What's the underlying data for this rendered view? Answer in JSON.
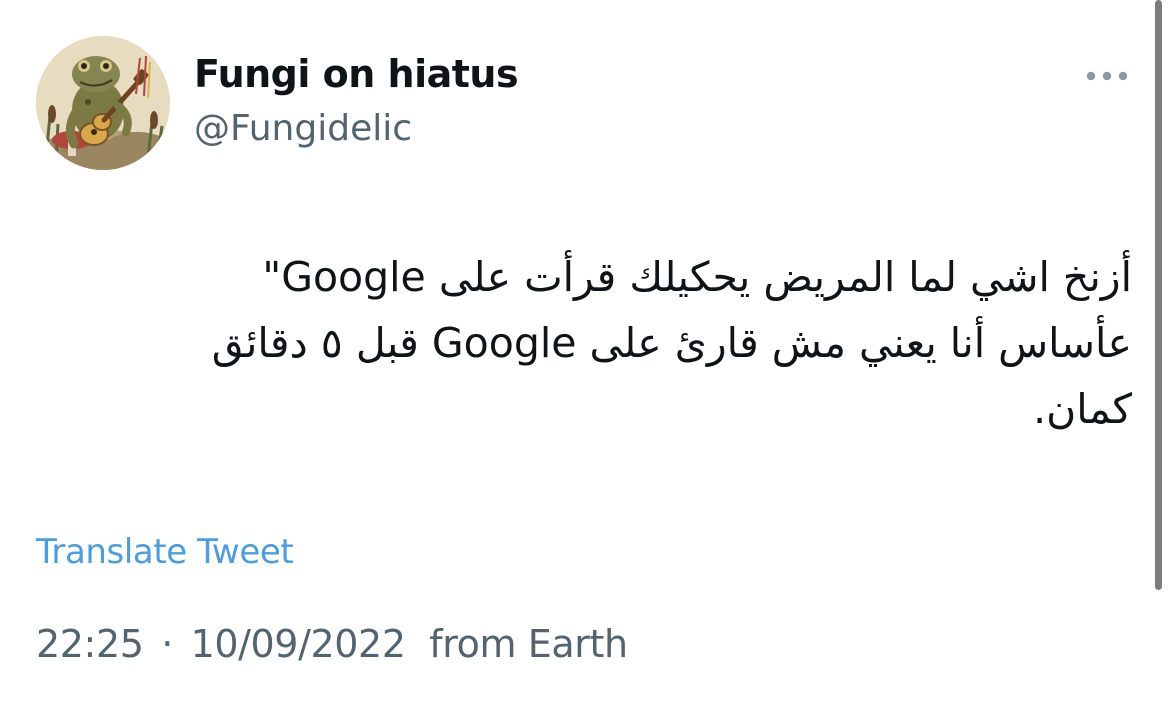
{
  "tweet": {
    "author": {
      "display_name": "Fungi on hiatus",
      "handle": "@Fungidelic",
      "avatar_icon": "frog-playing-guitar-avatar"
    },
    "more_icon": "more-horizontal-icon",
    "text_lines": [
      "أزنخ اشي لما المريض يحكيلك  قرأت على Google\"",
      "عأساس أنا يعني مش قارئ على Google قبل ٥ دقائق",
      "كمان."
    ],
    "translate_label": "Translate Tweet",
    "meta": {
      "time": "22:25",
      "separator": "·",
      "date": "10/09/2022",
      "source": "from Earth"
    }
  },
  "colors": {
    "text_primary": "#0f1419",
    "text_secondary": "#536471",
    "link": "#4a9de0",
    "background": "#ffffff",
    "scrollbar": "#7d7d7d"
  }
}
